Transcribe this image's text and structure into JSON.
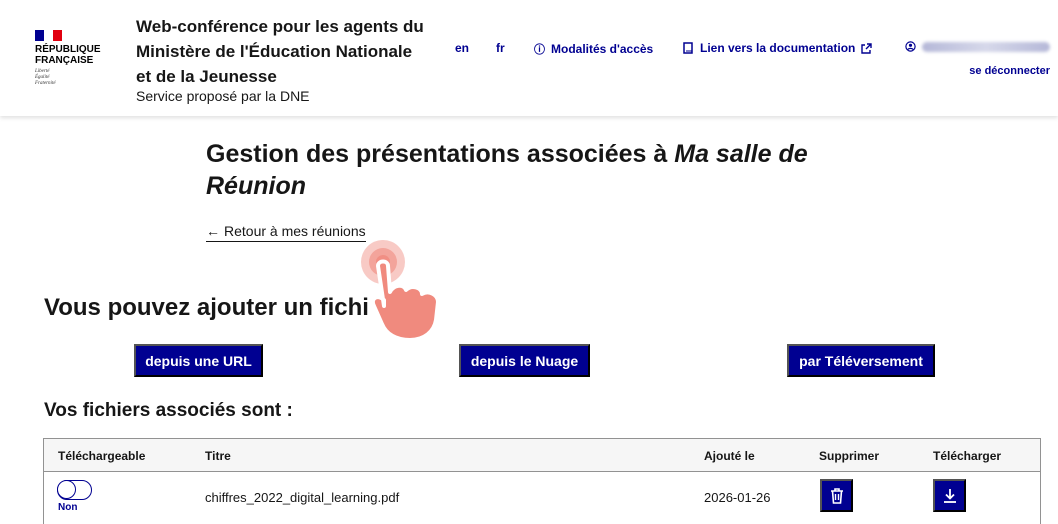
{
  "header": {
    "republic": "RÉPUBLIQUE\nFRANÇAISE",
    "motto": "Liberté\nÉgalité\nFraternité",
    "site_title": "Web-conférence pour les agents du Ministère de l'Éducation Nationale et de la Jeunesse",
    "tagline": "Service proposé par la DNE",
    "nav": {
      "lang_en": "en",
      "lang_fr": "fr",
      "access": "Modalités d'accès",
      "docs": "Lien vers la documentation",
      "logout": "se déconnecter"
    }
  },
  "main": {
    "title_plain": "Gestion des présentations associées à ",
    "title_room": "Ma salle de Réunion",
    "back_link": "Retour à mes réunions",
    "add_heading": "Vous pouvez ajouter un fichi",
    "buttons": {
      "url": "depuis une URL",
      "nuage": "depuis le Nuage",
      "upload": "par Téléversement"
    },
    "files_heading": "Vos fichiers associés sont :",
    "table": {
      "headers": [
        "Téléchargeable",
        "Titre",
        "Ajouté le",
        "Supprimer",
        "Télécharger"
      ],
      "rows": [
        {
          "downloadable": "Non",
          "title": "chiffres_2022_digital_learning.pdf",
          "added": "2026-01-26"
        }
      ]
    }
  },
  "colors": {
    "accent": "#000091",
    "marianne_red": "#e1000f",
    "pointer": "#f08a7e"
  },
  "icons": [
    "info-icon",
    "book-icon",
    "external-link-icon",
    "user-icon",
    "arrow-left-icon",
    "trash-icon",
    "download-icon",
    "hand-pointer-icon"
  ]
}
